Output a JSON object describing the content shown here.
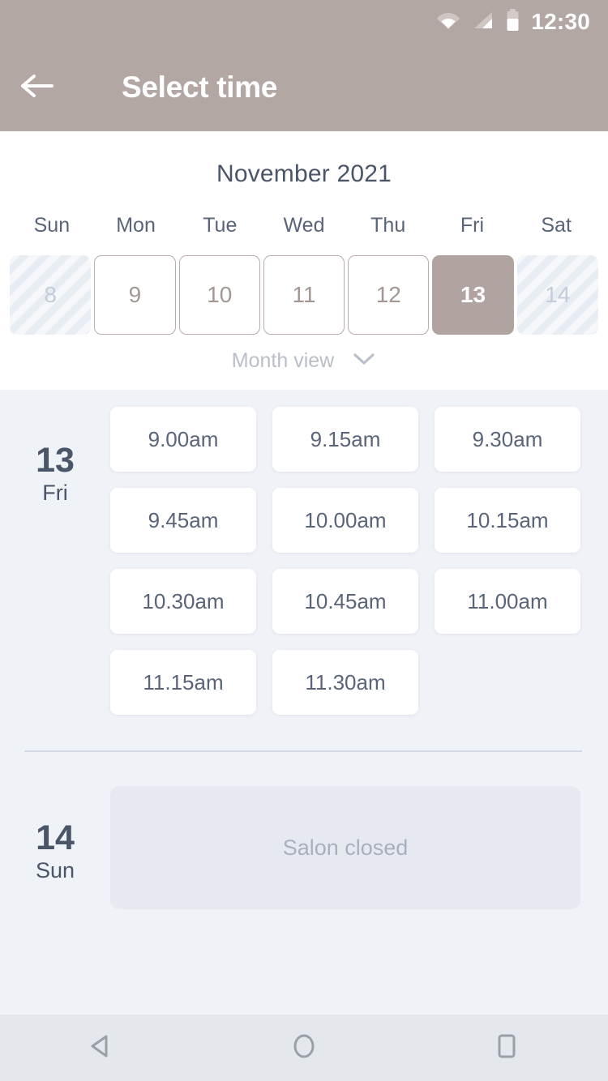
{
  "status_bar": {
    "time": "12:30",
    "icons": [
      "wifi-icon",
      "cellular-signal-icon",
      "battery-icon"
    ]
  },
  "app_bar": {
    "back_icon": "back-arrow-icon",
    "title": "Select time"
  },
  "calendar": {
    "month_title": "November 2021",
    "weekdays": [
      "Sun",
      "Mon",
      "Tue",
      "Wed",
      "Thu",
      "Fri",
      "Sat"
    ],
    "dates": [
      {
        "day": "8",
        "state": "disabled"
      },
      {
        "day": "9",
        "state": "enabled"
      },
      {
        "day": "10",
        "state": "enabled"
      },
      {
        "day": "11",
        "state": "enabled"
      },
      {
        "day": "12",
        "state": "enabled"
      },
      {
        "day": "13",
        "state": "selected"
      },
      {
        "day": "14",
        "state": "disabled"
      }
    ],
    "view_toggle": {
      "label": "Month view",
      "icon": "chevron-down-icon"
    }
  },
  "schedule": {
    "days": [
      {
        "day_number": "13",
        "day_of_week": "Fri",
        "closed": false,
        "slots": [
          "9.00am",
          "9.15am",
          "9.30am",
          "9.45am",
          "10.00am",
          "10.15am",
          "10.30am",
          "10.45am",
          "11.00am",
          "11.15am",
          "11.30am"
        ]
      },
      {
        "day_number": "14",
        "day_of_week": "Sun",
        "closed": true,
        "closed_message": "Salon closed",
        "slots": []
      }
    ]
  },
  "nav_bar": {
    "back": "nav-back-icon",
    "home": "nav-home-icon",
    "recents": "nav-recents-icon"
  },
  "colors": {
    "app_bar": "#b3a7a4",
    "selected_date": "#b0a3a0",
    "content_bg": "#eff2f7",
    "text_dark": "#4a5568",
    "slot_card": "#ffffff",
    "closed_box": "#e6eaf0",
    "nav_bar": "#e4e7ec"
  }
}
